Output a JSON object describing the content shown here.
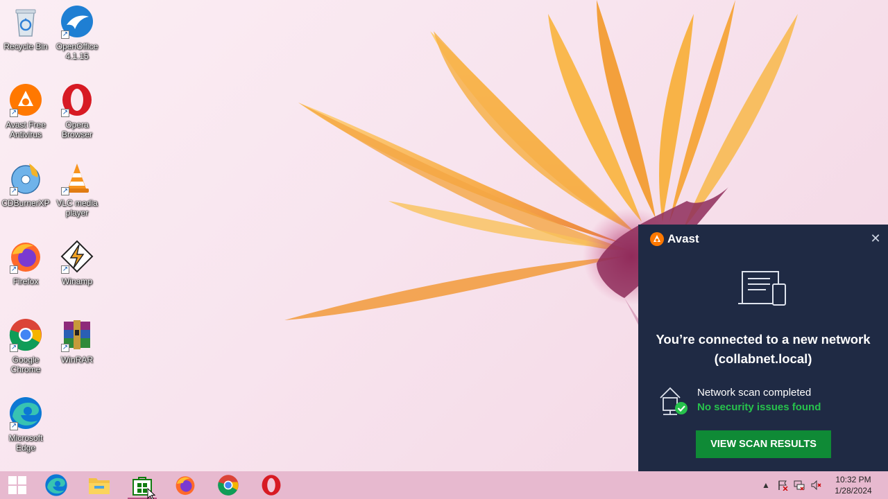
{
  "desktop": {
    "icons": [
      {
        "name": "recycle-bin",
        "label": "Recycle Bin"
      },
      {
        "name": "openoffice",
        "label": "OpenOffice 4.1.15"
      },
      {
        "name": "avast-free-antivirus",
        "label": "Avast Free Antivirus"
      },
      {
        "name": "opera-browser",
        "label": "Opera Browser"
      },
      {
        "name": "cdburnerxp",
        "label": "CDBurnerXP"
      },
      {
        "name": "vlc-media-player",
        "label": "VLC media player"
      },
      {
        "name": "firefox",
        "label": "Firefox"
      },
      {
        "name": "winamp",
        "label": "Winamp"
      },
      {
        "name": "google-chrome",
        "label": "Google Chrome"
      },
      {
        "name": "winrar",
        "label": "WinRAR"
      },
      {
        "name": "microsoft-edge",
        "label": "Microsoft Edge"
      }
    ]
  },
  "taskbar": {
    "apps": [
      "start-icon",
      "edge-icon",
      "file-explorer-icon",
      "store-icon",
      "firefox-icon",
      "chrome-icon",
      "opera-icon"
    ],
    "tray": {
      "time": "10:32 PM",
      "date": "1/28/2024"
    }
  },
  "avast_popup": {
    "brand": "Avast",
    "heading": "You’re connected to a new network (collabnet.local)",
    "status_line": "Network scan completed",
    "status_result": "No security issues found",
    "button_label": "VIEW SCAN RESULTS",
    "colors": {
      "background": "#1f2a44",
      "accent_green": "#27c24c",
      "button": "#0f8a36",
      "brand_orange": "#ff7800"
    }
  }
}
